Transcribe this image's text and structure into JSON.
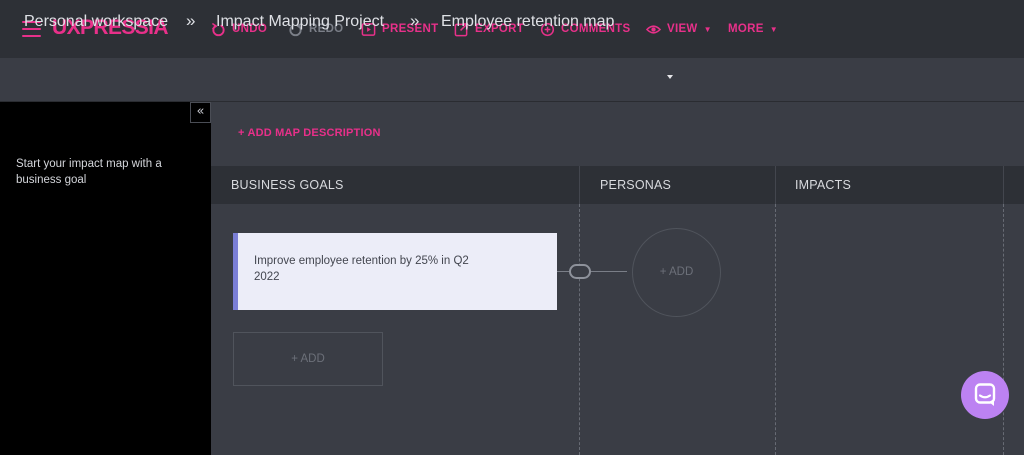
{
  "app": {
    "logo": "UXPRESSIA"
  },
  "toolbar": {
    "undo": "UNDO",
    "redo": "REDO",
    "present": "PRESENT",
    "export": "EXPORT",
    "comments": "COMMENTS",
    "view": "VIEW",
    "more": "MORE"
  },
  "breadcrumb": {
    "workspace": "Personal workspace",
    "project": "Impact Mapping Project",
    "map": "Employee retention map",
    "separator": "»"
  },
  "sidebar": {
    "collapse_glyph": "«",
    "hint": "Start your impact map with a business goal"
  },
  "map": {
    "add_description": "+ ADD MAP DESCRIPTION",
    "columns": [
      "BUSINESS GOALS",
      "PERSONAS",
      "IMPACTS"
    ],
    "goal": {
      "text": "Improve employee retention by 25% in Q2 2022"
    },
    "add_persona": "+ ADD",
    "add_goal": "+ ADD"
  },
  "colors": {
    "accent": "#e8308a",
    "topbar": "#2d3036",
    "canvas": "#3a3d45",
    "goal_card": "#ecedf8",
    "goal_border": "#7b7fd6",
    "chat_button": "#bc82f2"
  }
}
